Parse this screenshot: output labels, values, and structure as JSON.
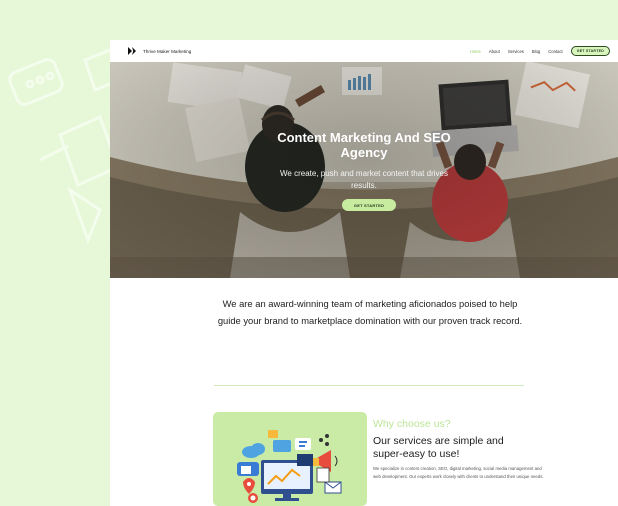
{
  "nav": {
    "brand": "Thrive Maker Marketing",
    "links": [
      "Home",
      "About",
      "Services",
      "Blog",
      "Contact"
    ],
    "cta": "GET STARTED"
  },
  "hero": {
    "title": "Content Marketing And SEO Agency",
    "subtitle": "We create, push and market content that drives results.",
    "cta": "GET STARTED"
  },
  "intro": {
    "text": "We are an award-winning team of marketing aficionados poised to help guide your brand to marketplace domination with our proven track record."
  },
  "why": {
    "kicker": "Why choose us?",
    "title": "Our services are simple and super-easy to use!",
    "body": "We specialize in content creation, SEO, digital marketing, social media management and web development. Our experts work closely with clients to understand their unique needs."
  },
  "colors": {
    "page_bg": "#e6f8d7",
    "accent": "#c7ec9f",
    "active_link": "#9bcf6b"
  }
}
